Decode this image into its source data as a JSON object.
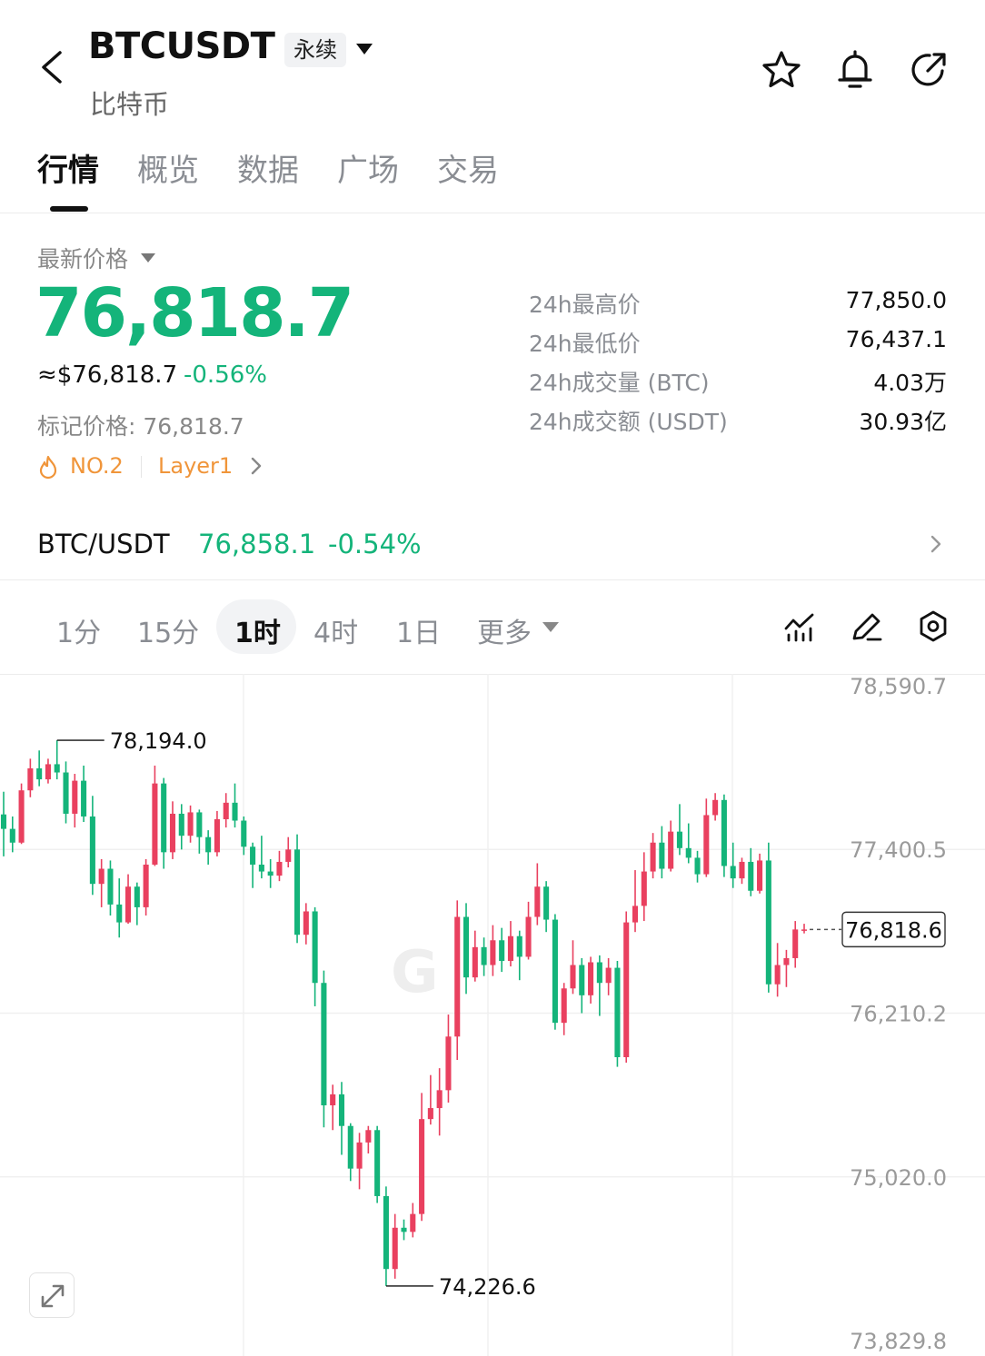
{
  "header": {
    "symbol": "BTCUSDT",
    "contract_type": "永续",
    "subtitle": "比特币",
    "icons": [
      "back-icon",
      "star-icon",
      "bell-icon",
      "share-icon"
    ]
  },
  "tabs": [
    {
      "label": "行情",
      "active": true
    },
    {
      "label": "概览",
      "active": false
    },
    {
      "label": "数据",
      "active": false
    },
    {
      "label": "广场",
      "active": false
    },
    {
      "label": "交易",
      "active": false
    }
  ],
  "price": {
    "label": "最新价格",
    "last": "76,818.7",
    "usd": "≈$76,818.7",
    "change_pct": "-0.56%",
    "mark": "标记价格: 76,818.7",
    "rank": "NO.2",
    "sector": "Layer1"
  },
  "stats": [
    {
      "label": "24h最高价",
      "value": "77,850.0"
    },
    {
      "label": "24h最低价",
      "value": "76,437.1"
    },
    {
      "label": "24h成交量 (BTC)",
      "value": "4.03万"
    },
    {
      "label": "24h成交额 (USDT)",
      "value": "30.93亿"
    }
  ],
  "spot": {
    "pair": "BTC/USDT",
    "price": "76,858.1",
    "change_pct": "-0.54%"
  },
  "intervals": [
    {
      "label": "1分",
      "active": false
    },
    {
      "label": "15分",
      "active": false
    },
    {
      "label": "1时",
      "active": true
    },
    {
      "label": "4时",
      "active": false
    },
    {
      "label": "1日",
      "active": false
    },
    {
      "label": "更多",
      "active": false
    }
  ],
  "colors": {
    "up": "#e9405f",
    "down": "#14b47a",
    "accent_orange": "#f0953a"
  },
  "chart_data": {
    "type": "candlestick",
    "interval": "1时",
    "y_ticks": [
      "78,590.7",
      "77,400.5",
      "76,210.2",
      "75,020.0",
      "73,829.8"
    ],
    "ylim": [
      73829.8,
      78590.7
    ],
    "grid": true,
    "high_label": "78,194.0",
    "low_label": "74,226.6",
    "current_label": "76,818.6",
    "current_value": 76818.6,
    "high_value": 78194.0,
    "low_value": 74226.6,
    "candles": [
      [
        77655,
        77820,
        77350,
        77550
      ],
      [
        77550,
        77640,
        77380,
        77450
      ],
      [
        77450,
        77880,
        77440,
        77830
      ],
      [
        77830,
        78060,
        77780,
        77990
      ],
      [
        77990,
        78120,
        77860,
        77910
      ],
      [
        77910,
        78060,
        77880,
        78020
      ],
      [
        78020,
        78194,
        77910,
        77960
      ],
      [
        77960,
        78040,
        77590,
        77660
      ],
      [
        77660,
        77950,
        77560,
        77900
      ],
      [
        77900,
        78010,
        77600,
        77640
      ],
      [
        77640,
        77790,
        77070,
        77150
      ],
      [
        77150,
        77330,
        76980,
        77260
      ],
      [
        77260,
        77320,
        76920,
        77000
      ],
      [
        77000,
        77190,
        76760,
        76870
      ],
      [
        76870,
        77220,
        76860,
        77130
      ],
      [
        77130,
        77160,
        76850,
        76980
      ],
      [
        76980,
        77330,
        76920,
        77290
      ],
      [
        77290,
        78010,
        77280,
        77880
      ],
      [
        77880,
        77920,
        77260,
        77380
      ],
      [
        77380,
        77750,
        77330,
        77660
      ],
      [
        77660,
        77730,
        77400,
        77500
      ],
      [
        77500,
        77720,
        77450,
        77670
      ],
      [
        77670,
        77690,
        77370,
        77490
      ],
      [
        77490,
        77540,
        77290,
        77380
      ],
      [
        77380,
        77680,
        77350,
        77620
      ],
      [
        77620,
        77810,
        77560,
        77740
      ],
      [
        77740,
        77880,
        77560,
        77610
      ],
      [
        77610,
        77640,
        77360,
        77420
      ],
      [
        77420,
        77450,
        77120,
        77290
      ],
      [
        77290,
        77500,
        77190,
        77240
      ],
      [
        77240,
        77330,
        77120,
        77210
      ],
      [
        77210,
        77390,
        77170,
        77310
      ],
      [
        77310,
        77490,
        77270,
        77400
      ],
      [
        77400,
        77510,
        76720,
        76780
      ],
      [
        76780,
        77010,
        76710,
        76950
      ],
      [
        76950,
        76980,
        76260,
        76430
      ],
      [
        76430,
        76520,
        75380,
        75540
      ],
      [
        75540,
        75690,
        75360,
        75620
      ],
      [
        75620,
        75710,
        75180,
        75390
      ],
      [
        75390,
        75410,
        74990,
        75080
      ],
      [
        75080,
        75340,
        74930,
        75270
      ],
      [
        75270,
        75390,
        75190,
        75360
      ],
      [
        75360,
        75390,
        74830,
        74880
      ],
      [
        74880,
        74950,
        74226.6,
        74350
      ],
      [
        74350,
        74750,
        74280,
        74650
      ],
      [
        74650,
        74710,
        74560,
        74620
      ],
      [
        74620,
        74830,
        74580,
        74750
      ],
      [
        74750,
        75630,
        74700,
        75440
      ],
      [
        75440,
        75760,
        75400,
        75520
      ],
      [
        75520,
        75810,
        75320,
        75650
      ],
      [
        75650,
        76200,
        75560,
        76040
      ],
      [
        76040,
        77030,
        75870,
        76910
      ],
      [
        76910,
        77010,
        76350,
        76470
      ],
      [
        76470,
        76810,
        76440,
        76690
      ],
      [
        76690,
        76760,
        76480,
        76560
      ],
      [
        76560,
        76850,
        76480,
        76740
      ],
      [
        76740,
        76830,
        76510,
        76590
      ],
      [
        76590,
        76880,
        76550,
        76770
      ],
      [
        76770,
        76810,
        76450,
        76620
      ],
      [
        76620,
        77020,
        76600,
        76910
      ],
      [
        76910,
        77300,
        76850,
        77130
      ],
      [
        77130,
        77170,
        76800,
        76890
      ],
      [
        76890,
        76930,
        76090,
        76140
      ],
      [
        76140,
        76430,
        76050,
        76390
      ],
      [
        76390,
        76740,
        76350,
        76560
      ],
      [
        76560,
        76610,
        76210,
        76340
      ],
      [
        76340,
        76620,
        76280,
        76580
      ],
      [
        76580,
        76630,
        76190,
        76430
      ],
      [
        76430,
        76610,
        76340,
        76540
      ],
      [
        76540,
        76590,
        75820,
        75890
      ],
      [
        75890,
        76950,
        75850,
        76870
      ],
      [
        76870,
        77250,
        76800,
        76990
      ],
      [
        76990,
        77380,
        76880,
        77240
      ],
      [
        77240,
        77520,
        77190,
        77450
      ],
      [
        77450,
        77570,
        77190,
        77260
      ],
      [
        77260,
        77610,
        77240,
        77530
      ],
      [
        77530,
        77730,
        77360,
        77410
      ],
      [
        77410,
        77590,
        77300,
        77340
      ],
      [
        77340,
        77390,
        77160,
        77220
      ],
      [
        77220,
        77770,
        77200,
        77650
      ],
      [
        77650,
        77810,
        77610,
        77760
      ],
      [
        77760,
        77800,
        77200,
        77280
      ],
      [
        77280,
        77450,
        77120,
        77190
      ],
      [
        77190,
        77340,
        77150,
        77310
      ],
      [
        77310,
        77410,
        77060,
        77100
      ],
      [
        77100,
        77370,
        77080,
        77320
      ],
      [
        77320,
        77450,
        76360,
        76420
      ],
      [
        76420,
        76720,
        76330,
        76560
      ],
      [
        76560,
        76670,
        76400,
        76610
      ],
      [
        76610,
        76880,
        76540,
        76818.6
      ],
      [
        76818.6,
        76860,
        76790,
        76818.6
      ]
    ]
  }
}
